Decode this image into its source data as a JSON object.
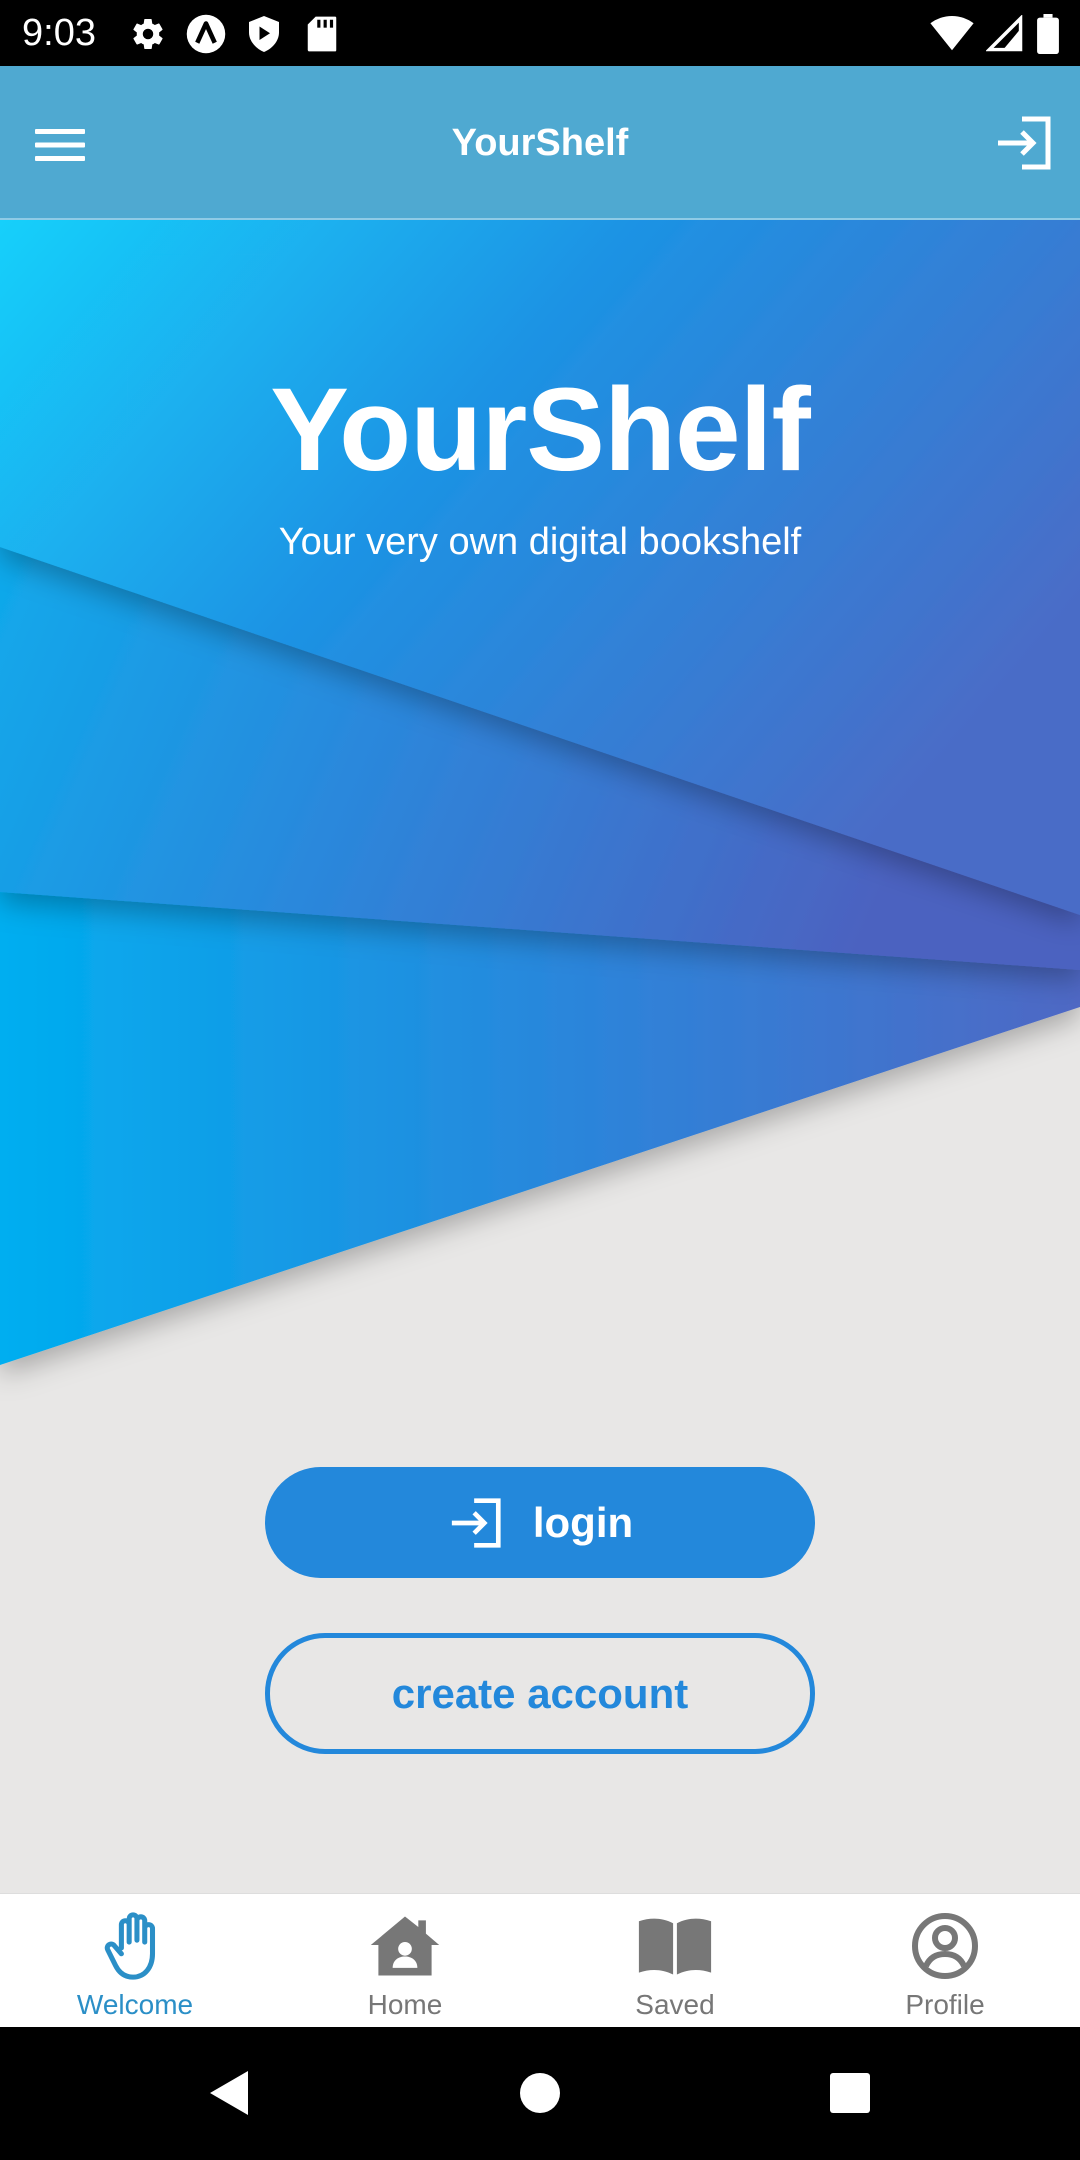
{
  "status_bar": {
    "time": "9:03",
    "left_icons": [
      "settings-icon",
      "a-badge-icon",
      "play-shield-icon",
      "sd-card-icon"
    ],
    "right_icons": [
      "wifi-icon",
      "cell-signal-icon",
      "battery-icon"
    ]
  },
  "app_bar": {
    "title": "YourShelf",
    "left_icon": "menu-icon",
    "right_icon": "login-icon"
  },
  "hero": {
    "title": "YourShelf",
    "subtitle": "Your very own digital bookshelf"
  },
  "actions": {
    "login_label": "login",
    "login_icon": "login-icon",
    "create_account_label": "create account"
  },
  "bottom_nav": {
    "items": [
      {
        "label": "Welcome",
        "icon": "hand-icon",
        "active": true
      },
      {
        "label": "Home",
        "icon": "home-icon",
        "active": false
      },
      {
        "label": "Saved",
        "icon": "book-icon",
        "active": false
      },
      {
        "label": "Profile",
        "icon": "profile-icon",
        "active": false
      }
    ]
  },
  "colors": {
    "primary": "#2388db",
    "app_bar": "#4fa9d1",
    "active_nav": "#2b8fc7",
    "inactive_nav": "#777777",
    "background": "#e8e7e6"
  },
  "system_nav": [
    "back-icon",
    "home-circle-icon",
    "recents-icon"
  ]
}
